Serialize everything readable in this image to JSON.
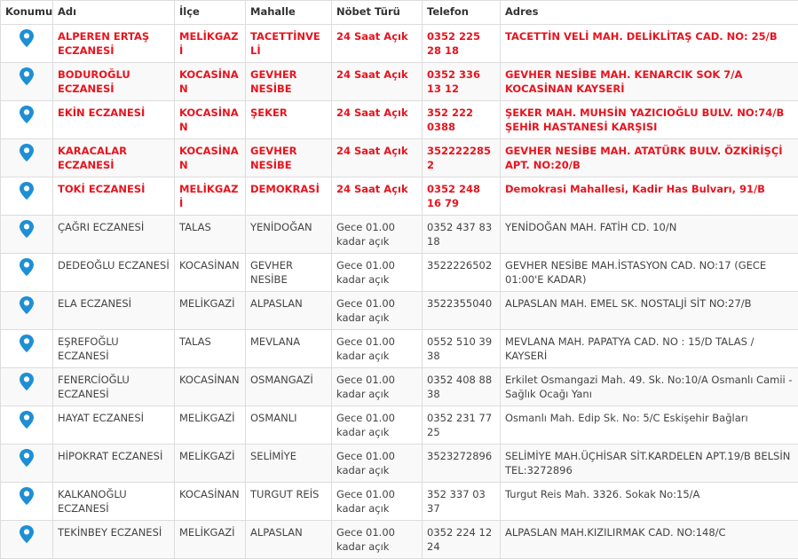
{
  "table": {
    "columns": [
      "Konumu",
      "Adı",
      "İlçe",
      "Mahalle",
      "Nöbet Türü",
      "Telefon",
      "Adres"
    ],
    "rows": [
      {
        "highlight": true,
        "name": "ALPEREN ERTAŞ ECZANESİ",
        "district": "MELİKGAZİ",
        "neighborhood": "TACETTİNVELİ",
        "duty": "24 Saat Açık",
        "phone": "0352 225 28 18",
        "address": "TACETTİN VELİ MAH. DELİKLİTAŞ CAD. NO: 25/B"
      },
      {
        "highlight": true,
        "name": "BODUROĞLU ECZANESİ",
        "district": "KOCASİNAN",
        "neighborhood": "GEVHER NESİBE",
        "duty": "24 Saat Açık",
        "phone": "0352 336 13 12",
        "address": "GEVHER NESİBE MAH. KENARCIK SOK 7/A KOCASİNAN KAYSERİ"
      },
      {
        "highlight": true,
        "name": "EKİN ECZANESİ",
        "district": "KOCASİNAN",
        "neighborhood": "ŞEKER",
        "duty": "24 Saat Açık",
        "phone": "352 222 0388",
        "address": "ŞEKER MAH. MUHSİN YAZICIOĞLU BULV. NO:74/B ŞEHİR HASTANESİ KARŞISI"
      },
      {
        "highlight": true,
        "name": "KARACALAR ECZANESİ",
        "district": "KOCASİNAN",
        "neighborhood": "GEVHER NESİBE",
        "duty": "24 Saat Açık",
        "phone": "3522222852",
        "address": "GEVHER NESİBE MAH. ATATÜRK BULV. ÖZKİRİŞÇİ APT. NO:20/B"
      },
      {
        "highlight": true,
        "name": "TOKİ ECZANESİ",
        "district": "MELİKGAZİ",
        "neighborhood": "DEMOKRASİ",
        "duty": "24 Saat Açık",
        "phone": "0352 248 16 79",
        "address": "Demokrasi Mahallesi, Kadir Has Bulvarı, 91/B"
      },
      {
        "highlight": false,
        "name": "ÇAĞRI ECZANESİ",
        "district": "TALAS",
        "neighborhood": "YENİDOĞAN",
        "duty": "Gece 01.00 kadar açık",
        "phone": "0352 437 83 18",
        "address": "YENİDOĞAN MAH. FATİH CD. 10/N"
      },
      {
        "highlight": false,
        "name": "DEDEOĞLU ECZANESİ",
        "district": "KOCASİNAN",
        "neighborhood": "GEVHER NESİBE",
        "duty": "Gece 01.00 kadar açık",
        "phone": "3522226502",
        "address": "GEVHER NESİBE MAH.İSTASYON CAD. NO:17 (GECE 01:00'E KADAR)"
      },
      {
        "highlight": false,
        "name": "ELA ECZANESİ",
        "district": "MELİKGAZİ",
        "neighborhood": "ALPASLAN",
        "duty": "Gece 01.00 kadar açık",
        "phone": "3522355040",
        "address": "ALPASLAN MAH. EMEL SK. NOSTALJİ SİT NO:27/B"
      },
      {
        "highlight": false,
        "name": "EŞREFOĞLU ECZANESİ",
        "district": "TALAS",
        "neighborhood": "MEVLANA",
        "duty": "Gece 01.00 kadar açık",
        "phone": "0552 510 39 38",
        "address": "MEVLANA MAH. PAPATYA CAD. NO : 15/D TALAS / KAYSERİ"
      },
      {
        "highlight": false,
        "name": "FENERCİOĞLU ECZANESİ",
        "district": "KOCASİNAN",
        "neighborhood": "OSMANGAZİ",
        "duty": "Gece 01.00 kadar açık",
        "phone": "0352 408 88 38",
        "address": "Erkilet Osmangazi Mah. 49. Sk. No:10/A Osmanlı Camii - Sağlık Ocağı Yanı"
      },
      {
        "highlight": false,
        "name": "HAYAT ECZANESİ",
        "district": "MELİKGAZİ",
        "neighborhood": "OSMANLI",
        "duty": "Gece 01.00 kadar açık",
        "phone": "0352 231 77 25",
        "address": "Osmanlı Mah. Edip Sk. No: 5/C Eskişehir Bağları"
      },
      {
        "highlight": false,
        "name": "HİPOKRAT ECZANESİ",
        "district": "MELİKGAZİ",
        "neighborhood": "SELİMİYE",
        "duty": "Gece 01.00 kadar açık",
        "phone": "3523272896",
        "address": "SELİMİYE MAH.ÜÇHİSAR SİT.KARDELEN APT.19/B BELSİN TEL:3272896"
      },
      {
        "highlight": false,
        "name": "KALKANOĞLU ECZANESİ",
        "district": "KOCASİNAN",
        "neighborhood": "TURGUT REİS",
        "duty": "Gece 01.00 kadar açık",
        "phone": "352 337 03 37",
        "address": "Turgut Reis Mah. 3326. Sokak No:15/A"
      },
      {
        "highlight": false,
        "name": "TEKİNBEY ECZANESİ",
        "district": "MELİKGAZİ",
        "neighborhood": "ALPASLAN",
        "duty": "Gece 01.00 kadar açık",
        "phone": "0352 224 12 24",
        "address": "ALPASLAN MAH.KIZILIRMAK CAD. NO:148/C"
      }
    ]
  },
  "icons": {
    "location": "map-pin-icon"
  },
  "colors": {
    "highlight_text": "#e8141e",
    "pin": "#1e8fd5",
    "border": "#dddddd"
  }
}
